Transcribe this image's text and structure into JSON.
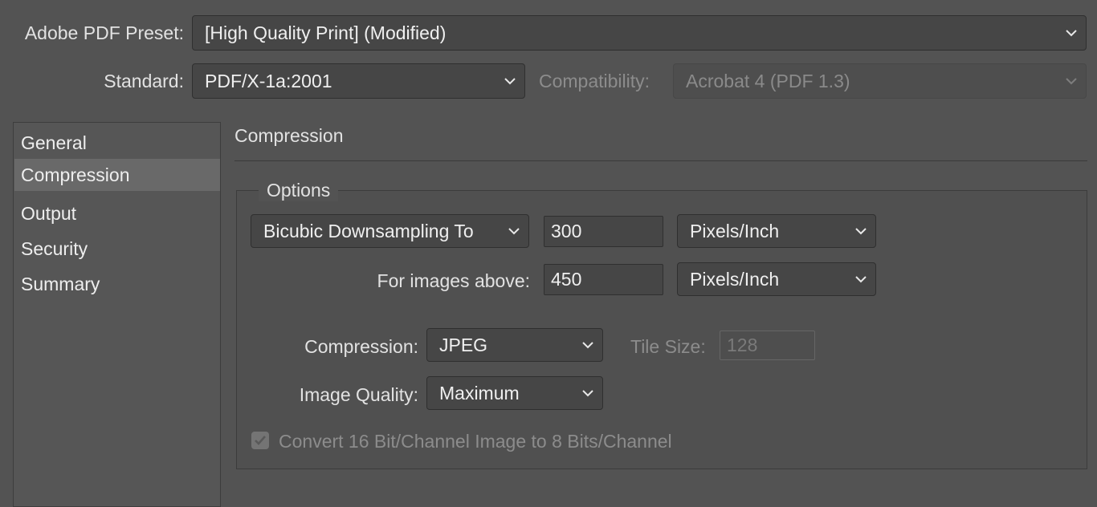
{
  "preset": {
    "label": "Adobe PDF Preset:",
    "value": "[High Quality Print] (Modified)"
  },
  "standard": {
    "label": "Standard:",
    "value": "PDF/X-1a:2001"
  },
  "compatibility": {
    "label": "Compatibility:",
    "value": "Acrobat 4 (PDF 1.3)"
  },
  "sidebar": {
    "items": [
      {
        "label": "General"
      },
      {
        "label": "Compression"
      },
      {
        "label": "Output"
      },
      {
        "label": "Security"
      },
      {
        "label": "Summary"
      }
    ],
    "selected": "Compression"
  },
  "panel": {
    "title": "Compression",
    "options_title": "Options",
    "downsampling": {
      "method": "Bicubic Downsampling To",
      "resolution": "300",
      "unit": "Pixels/Inch"
    },
    "images_above": {
      "label": "For images above:",
      "value": "450",
      "unit": "Pixels/Inch"
    },
    "compression": {
      "label": "Compression:",
      "value": "JPEG"
    },
    "tile_size": {
      "label": "Tile Size:",
      "value": "128"
    },
    "image_quality": {
      "label": "Image Quality:",
      "value": "Maximum"
    },
    "convert_16bit": {
      "label": "Convert 16 Bit/Channel Image to 8 Bits/Channel",
      "checked": true,
      "enabled": false
    }
  },
  "colors": {
    "background": "#535353",
    "field": "#464646",
    "selected_row": "#696969"
  }
}
